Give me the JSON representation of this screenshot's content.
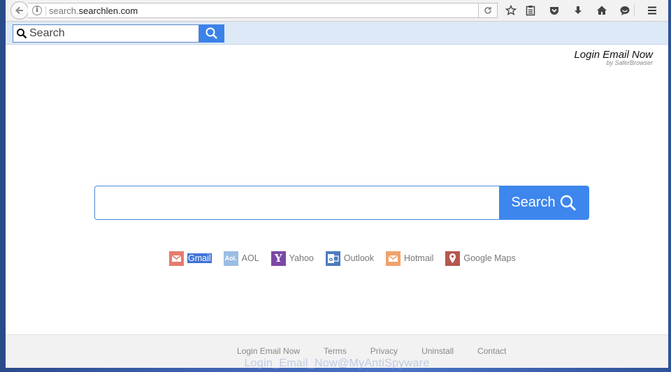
{
  "browser": {
    "url_prefix": "search.",
    "url_host": "searchlen.com"
  },
  "toolbar": {
    "search_placeholder": "Search"
  },
  "brand": {
    "title": "Login Email Now",
    "subtitle": "by SaferBrowser"
  },
  "main": {
    "search_value": "",
    "search_button": "Search"
  },
  "quicklinks": [
    {
      "label": "Gmail",
      "icon": "gmail-icon",
      "color": "#e57b6d",
      "selected": true
    },
    {
      "label": "AOL",
      "icon": "aol-icon",
      "color": "#9bbde3"
    },
    {
      "label": "Yahoo",
      "icon": "yahoo-icon",
      "color": "#7b48a6"
    },
    {
      "label": "Outlook",
      "icon": "outlook-icon",
      "color": "#4c7bc0"
    },
    {
      "label": "Hotmail",
      "icon": "hotmail-icon",
      "color": "#f0a36a"
    },
    {
      "label": "Google Maps",
      "icon": "map-pin-icon",
      "color": "#b5574f"
    }
  ],
  "footer": {
    "links": [
      "Login Email Now",
      "Terms",
      "Privacy",
      "Uninstall",
      "Contact"
    ]
  },
  "watermark": "Login_Email_Now@MyAntiSpyware"
}
